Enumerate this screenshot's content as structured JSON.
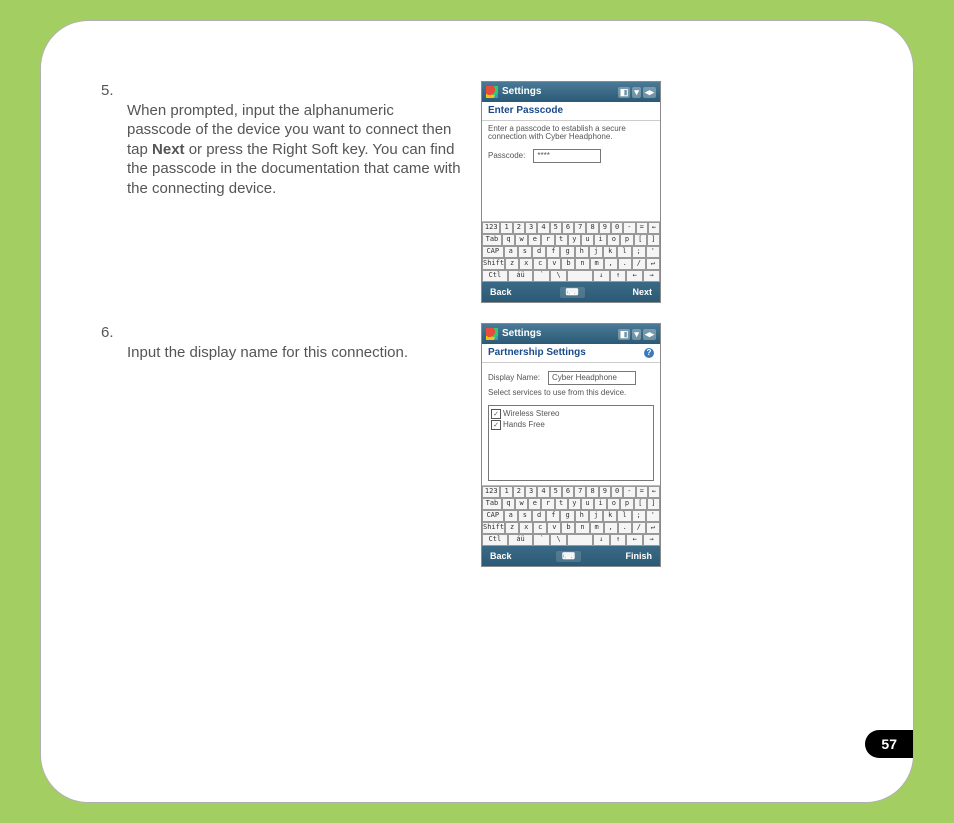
{
  "page_number": "57",
  "steps": [
    {
      "number": "5.",
      "text_before_bold": "When prompted, input the alphanumeric passcode of the device you want to connect then tap ",
      "bold": "Next",
      "text_after_bold": " or press the Right Soft key. You can find the passcode in the documentation that came with the connecting device."
    },
    {
      "number": "6.",
      "text_before_bold": "Input the display name for this connection.",
      "bold": "",
      "text_after_bold": ""
    }
  ],
  "screens": {
    "a": {
      "title": "Settings",
      "heading": "Enter Passcode",
      "instruction": "Enter a passcode to establish a secure connection with Cyber Headphone.",
      "field_label": "Passcode:",
      "field_value": "****",
      "soft_left": "Back",
      "soft_mid": "⌨",
      "soft_right": "Next"
    },
    "b": {
      "title": "Settings",
      "heading": "Partnership Settings",
      "dn_label": "Display Name:",
      "dn_value": "Cyber Headphone",
      "sub": "Select services to use from this device.",
      "svc1": "Wireless Stereo",
      "svc2": "Hands Free",
      "soft_left": "Back",
      "soft_mid": "⌨",
      "soft_right": "Finish"
    }
  },
  "keyboard": {
    "row1": [
      "123",
      "1",
      "2",
      "3",
      "4",
      "5",
      "6",
      "7",
      "8",
      "9",
      "0",
      "-",
      "=",
      "←"
    ],
    "row2": [
      "Tab",
      "q",
      "w",
      "e",
      "r",
      "t",
      "y",
      "u",
      "i",
      "o",
      "p",
      "[",
      "]"
    ],
    "row3": [
      "CAP",
      "a",
      "s",
      "d",
      "f",
      "g",
      "h",
      "j",
      "k",
      "l",
      ";",
      "'"
    ],
    "row4": [
      "Shift",
      "z",
      "x",
      "c",
      "v",
      "b",
      "n",
      "m",
      ",",
      ".",
      "/",
      "↵"
    ],
    "row5": [
      "Ctl",
      "áü",
      "`",
      "\\",
      " ",
      "↓",
      "↑",
      "←",
      "→"
    ]
  }
}
